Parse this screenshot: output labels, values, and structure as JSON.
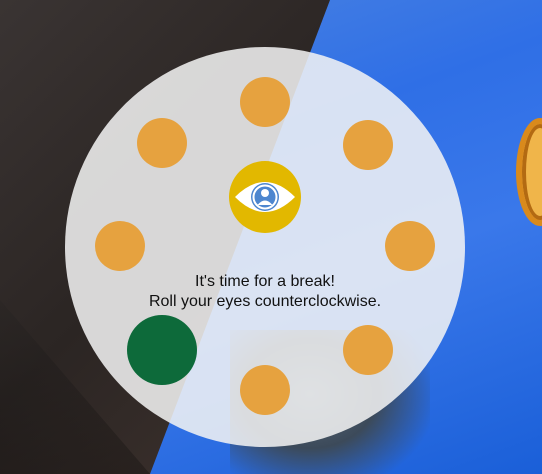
{
  "message": {
    "line1": "It's time for a break!",
    "line2": "Roll your eyes counterclockwise."
  },
  "exercise": {
    "direction": "counterclockwise",
    "total_positions": 8,
    "active_position": "bottom-left"
  },
  "icons": {
    "center": "eye-icon",
    "pupil": "person-icon"
  },
  "colors": {
    "dot_inactive": "#e6a23f",
    "dot_active": "#0d6a3a",
    "eye_badge": "#e2b800",
    "eye_white": "#ffffff",
    "iris": "#4d86cf",
    "panel": "#f5f5f5"
  }
}
